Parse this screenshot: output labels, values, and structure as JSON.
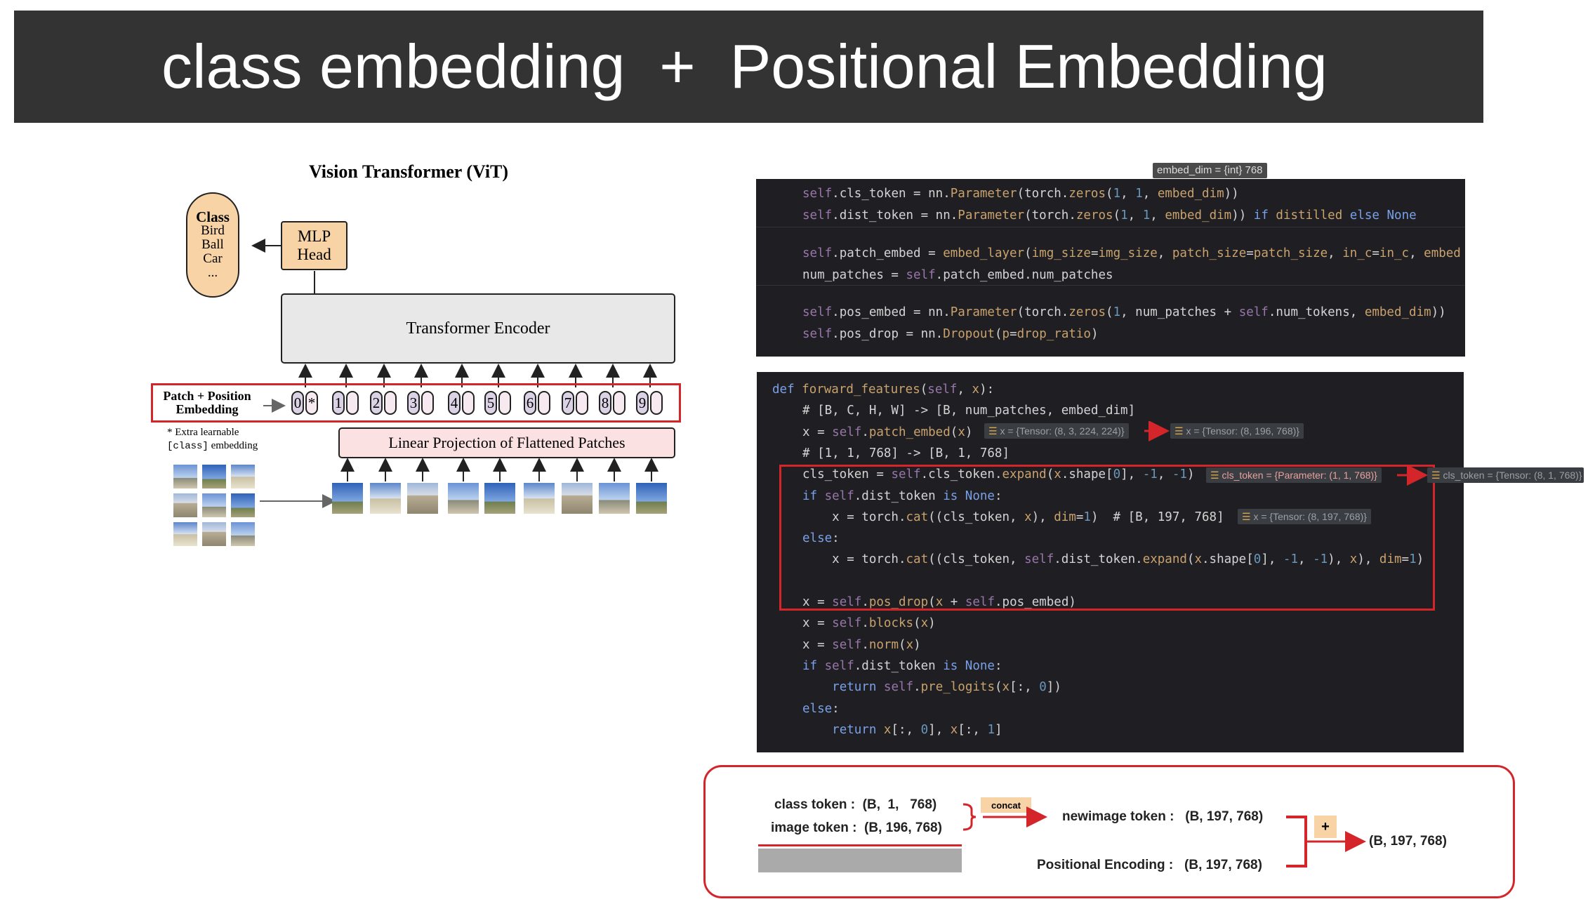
{
  "banner": {
    "title": "class embedding  +  Positional Embedding"
  },
  "vit": {
    "title": "Vision Transformer (ViT)",
    "class_box": {
      "title": "Class",
      "items": [
        "Bird",
        "Ball",
        "Car",
        "..."
      ]
    },
    "mlp_head": [
      "MLP",
      "Head"
    ],
    "encoder": "Transformer Encoder",
    "patch_label": [
      "Patch + Position",
      "Embedding"
    ],
    "extra_note": [
      "* Extra learnable",
      "[class]",
      " embedding"
    ],
    "linear_projection": "Linear Projection of Flattened Patches",
    "tokens": [
      {
        "num": "0",
        "emb": "*"
      },
      {
        "num": "1",
        "emb": ""
      },
      {
        "num": "2",
        "emb": ""
      },
      {
        "num": "3",
        "emb": ""
      },
      {
        "num": "4",
        "emb": ""
      },
      {
        "num": "5",
        "emb": ""
      },
      {
        "num": "6",
        "emb": ""
      },
      {
        "num": "7",
        "emb": ""
      },
      {
        "num": "8",
        "emb": ""
      },
      {
        "num": "9",
        "emb": ""
      }
    ]
  },
  "code_top": {
    "hint": "embed_dim = {int} 768",
    "lines": [
      [
        [
          "self",
          "#9876aa"
        ],
        [
          ".cls_token = nn.",
          ""
        ],
        [
          "Parameter",
          "#c9a26d"
        ],
        [
          "(torch.",
          ""
        ],
        [
          "zeros",
          "#c9a26d"
        ],
        [
          "(",
          ""
        ],
        [
          "1",
          "#6897bb"
        ],
        [
          ", ",
          ""
        ],
        [
          "1",
          "#6897bb"
        ],
        [
          ", ",
          ""
        ],
        [
          "embed_dim",
          "#c9a26d"
        ],
        [
          "))",
          ""
        ]
      ],
      [
        [
          "self",
          "#9876aa"
        ],
        [
          ".dist_token = nn.",
          ""
        ],
        [
          "Parameter",
          "#c9a26d"
        ],
        [
          "(torch.",
          ""
        ],
        [
          "zeros",
          "#c9a26d"
        ],
        [
          "(",
          ""
        ],
        [
          "1",
          "#6897bb"
        ],
        [
          ", ",
          ""
        ],
        [
          "1",
          "#6897bb"
        ],
        [
          ", ",
          ""
        ],
        [
          "embed_dim",
          "#c9a26d"
        ],
        [
          ")) ",
          ""
        ],
        [
          "if",
          "#7aa0e8"
        ],
        [
          " ",
          ""
        ],
        [
          "distilled",
          "#c9a26d"
        ],
        [
          " ",
          ""
        ],
        [
          "else",
          "#7aa0e8"
        ],
        [
          " ",
          ""
        ],
        [
          "None",
          "#7aa0e8"
        ]
      ],
      [
        [
          "self",
          "#9876aa"
        ],
        [
          ".patch_embed = ",
          ""
        ],
        [
          "embed_layer",
          "#c9a26d"
        ],
        [
          "(",
          ""
        ],
        [
          "img_size",
          "#c9a26d"
        ],
        [
          "=",
          ""
        ],
        [
          "img_size",
          "#c9a26d"
        ],
        [
          ", ",
          ""
        ],
        [
          "patch_size",
          "#c9a26d"
        ],
        [
          "=",
          ""
        ],
        [
          "patch_size",
          "#c9a26d"
        ],
        [
          ", ",
          ""
        ],
        [
          "in_c",
          "#c9a26d"
        ],
        [
          "=",
          ""
        ],
        [
          "in_c",
          "#c9a26d"
        ],
        [
          ", ",
          ""
        ],
        [
          "embed",
          "#c9a26d"
        ]
      ],
      [
        [
          "num_patches = ",
          ""
        ],
        [
          "self",
          "#9876aa"
        ],
        [
          ".patch_embed.num_patches",
          ""
        ]
      ],
      [
        [
          "self",
          "#9876aa"
        ],
        [
          ".pos_embed = nn.",
          ""
        ],
        [
          "Parameter",
          "#c9a26d"
        ],
        [
          "(torch.",
          ""
        ],
        [
          "zeros",
          "#c9a26d"
        ],
        [
          "(",
          ""
        ],
        [
          "1",
          "#6897bb"
        ],
        [
          ", num_patches + ",
          ""
        ],
        [
          "self",
          "#9876aa"
        ],
        [
          ".num_tokens, ",
          ""
        ],
        [
          "embed_dim",
          "#c9a26d"
        ],
        [
          "))",
          ""
        ]
      ],
      [
        [
          "self",
          "#9876aa"
        ],
        [
          ".pos_drop = nn.",
          ""
        ],
        [
          "Dropout",
          "#c9a26d"
        ],
        [
          "(",
          ""
        ],
        [
          "p",
          "#c9a26d"
        ],
        [
          "=",
          ""
        ],
        [
          "drop_ratio",
          "#c9a26d"
        ],
        [
          ")",
          ""
        ]
      ]
    ]
  },
  "code_bottom": {
    "lines": [
      [
        [
          "def ",
          "#7aa0e8"
        ],
        [
          "forward_features",
          "#c9a26d"
        ],
        [
          "(",
          ""
        ],
        [
          "self",
          "#9876aa"
        ],
        [
          ", ",
          ""
        ],
        [
          "x",
          "#c9a26d"
        ],
        [
          "):",
          ""
        ]
      ],
      [
        [
          "# [B, C, H, W] -> [B, num_patches, embed_dim]",
          ""
        ]
      ],
      [
        [
          "x = ",
          ""
        ],
        [
          "self",
          "#9876aa"
        ],
        [
          ".",
          ""
        ],
        [
          "patch_embed",
          "#c9a26d"
        ],
        [
          "(",
          ""
        ],
        [
          "x",
          "#c9a26d"
        ],
        [
          ")",
          ""
        ]
      ],
      [
        [
          "# [1, 1, 768] -> [B, 1, 768]",
          ""
        ]
      ],
      [
        [
          "cls_token = ",
          ""
        ],
        [
          "self",
          "#9876aa"
        ],
        [
          ".cls_token.",
          ""
        ],
        [
          "expand",
          "#c9a26d"
        ],
        [
          "(",
          ""
        ],
        [
          "x",
          "#c9a26d"
        ],
        [
          ".shape[",
          ""
        ],
        [
          "0",
          "#6897bb"
        ],
        [
          "], ",
          ""
        ],
        [
          "-1",
          "#6897bb"
        ],
        [
          ", ",
          ""
        ],
        [
          "-1",
          "#6897bb"
        ],
        [
          ")",
          ""
        ]
      ],
      [
        [
          "if ",
          "#7aa0e8"
        ],
        [
          "self",
          "#9876aa"
        ],
        [
          ".dist_token ",
          ""
        ],
        [
          "is None",
          "#7aa0e8"
        ],
        [
          ":",
          ""
        ]
      ],
      [
        [
          "    x = torch.",
          ""
        ],
        [
          "cat",
          "#c9a26d"
        ],
        [
          "((cls_token, ",
          ""
        ],
        [
          "x",
          "#c9a26d"
        ],
        [
          "), ",
          ""
        ],
        [
          "dim",
          "#c9a26d"
        ],
        [
          "=",
          ""
        ],
        [
          "1",
          "#6897bb"
        ],
        [
          ")  # [B, 197, 768]",
          ""
        ]
      ],
      [
        [
          "else",
          "#7aa0e8"
        ],
        [
          ":",
          ""
        ]
      ],
      [
        [
          "    x = torch.",
          ""
        ],
        [
          "cat",
          "#c9a26d"
        ],
        [
          "((cls_token, ",
          ""
        ],
        [
          "self",
          "#9876aa"
        ],
        [
          ".dist_token.",
          ""
        ],
        [
          "expand",
          "#c9a26d"
        ],
        [
          "(",
          ""
        ],
        [
          "x",
          "#c9a26d"
        ],
        [
          ".shape[",
          ""
        ],
        [
          "0",
          "#6897bb"
        ],
        [
          "], ",
          ""
        ],
        [
          "-1",
          "#6897bb"
        ],
        [
          ", ",
          ""
        ],
        [
          "-1",
          "#6897bb"
        ],
        [
          "), ",
          ""
        ],
        [
          "x",
          "#c9a26d"
        ],
        [
          "), ",
          ""
        ],
        [
          "dim",
          "#c9a26d"
        ],
        [
          "=",
          ""
        ],
        [
          "1",
          "#6897bb"
        ],
        [
          ")",
          ""
        ]
      ],
      [
        [
          "",
          ""
        ]
      ],
      [
        [
          "x = ",
          ""
        ],
        [
          "self",
          "#9876aa"
        ],
        [
          ".",
          ""
        ],
        [
          "pos_drop",
          "#c9a26d"
        ],
        [
          "(",
          ""
        ],
        [
          "x",
          "#c9a26d"
        ],
        [
          " + ",
          ""
        ],
        [
          "self",
          "#9876aa"
        ],
        [
          ".pos_embed)",
          ""
        ]
      ],
      [
        [
          "x = ",
          ""
        ],
        [
          "self",
          "#9876aa"
        ],
        [
          ".",
          ""
        ],
        [
          "blocks",
          "#c9a26d"
        ],
        [
          "(",
          ""
        ],
        [
          "x",
          "#c9a26d"
        ],
        [
          ")",
          ""
        ]
      ],
      [
        [
          "x = ",
          ""
        ],
        [
          "self",
          "#9876aa"
        ],
        [
          ".",
          ""
        ],
        [
          "norm",
          "#c9a26d"
        ],
        [
          "(",
          ""
        ],
        [
          "x",
          "#c9a26d"
        ],
        [
          ")",
          ""
        ]
      ],
      [
        [
          "if ",
          "#7aa0e8"
        ],
        [
          "self",
          "#9876aa"
        ],
        [
          ".dist_token ",
          ""
        ],
        [
          "is None",
          "#7aa0e8"
        ],
        [
          ":",
          ""
        ]
      ],
      [
        [
          "    ",
          ""
        ],
        [
          "return ",
          "#7aa0e8"
        ],
        [
          "self",
          "#9876aa"
        ],
        [
          ".",
          ""
        ],
        [
          "pre_logits",
          "#c9a26d"
        ],
        [
          "(",
          ""
        ],
        [
          "x",
          "#c9a26d"
        ],
        [
          "[:, ",
          ""
        ],
        [
          "0",
          "#6897bb"
        ],
        [
          "])",
          ""
        ]
      ],
      [
        [
          "else",
          "#7aa0e8"
        ],
        [
          ":",
          ""
        ]
      ],
      [
        [
          "    ",
          ""
        ],
        [
          "return ",
          "#7aa0e8"
        ],
        [
          "x",
          "#c9a26d"
        ],
        [
          "[:, ",
          ""
        ],
        [
          "0",
          "#6897bb"
        ],
        [
          "], ",
          ""
        ],
        [
          "x",
          "#c9a26d"
        ],
        [
          "[:, ",
          ""
        ],
        [
          "1",
          "#6897bb"
        ],
        [
          "]",
          ""
        ]
      ]
    ],
    "hints": {
      "x_in": "x = {Tensor: (8, 3, 224, 224)}",
      "x_out": "x = {Tensor: (8, 196, 768)}",
      "cls_param": "cls_token = {Parameter: (1, 1, 768)}",
      "cls_tensor": "cls_token = {Tensor: (8, 1, 768)}",
      "x_cat": "x = {Tensor: (8, 197, 768)}"
    }
  },
  "summary": {
    "class_token": "class token :  (B,  1,   768)",
    "image_token": "image token :  (B, 196, 768)",
    "concat": "concat",
    "newimage_token": "newimage token :   (B, 197, 768)",
    "positional_encoding": "Positional Encoding :   (B, 197, 768)",
    "plus": "+",
    "result": "(B, 197, 768)"
  },
  "colors": {
    "accent_red": "#d4262a",
    "peach": "#f7d3a6",
    "code_bg": "#1f1f23"
  }
}
